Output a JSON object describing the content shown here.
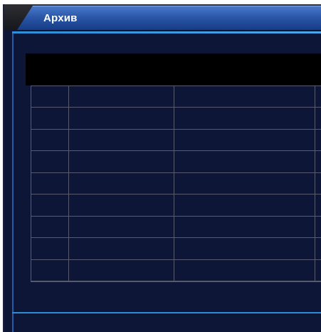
{
  "window": {
    "title": "Архив"
  },
  "table": {
    "rows": 9,
    "columns": 4,
    "cells": [
      [
        "",
        "",
        "",
        ""
      ],
      [
        "",
        "",
        "",
        ""
      ],
      [
        "",
        "",
        "",
        ""
      ],
      [
        "",
        "",
        "",
        ""
      ],
      [
        "",
        "",
        "",
        ""
      ],
      [
        "",
        "",
        "",
        ""
      ],
      [
        "",
        "",
        "",
        ""
      ],
      [
        "",
        "",
        "",
        ""
      ],
      [
        "",
        "",
        "",
        ""
      ]
    ]
  },
  "colors": {
    "window_background": "#0d1636",
    "title_bar": "#2b57a8",
    "accent_line": "#2c8fd8",
    "header_bar": "#000000",
    "grid_line": "#57596d"
  }
}
